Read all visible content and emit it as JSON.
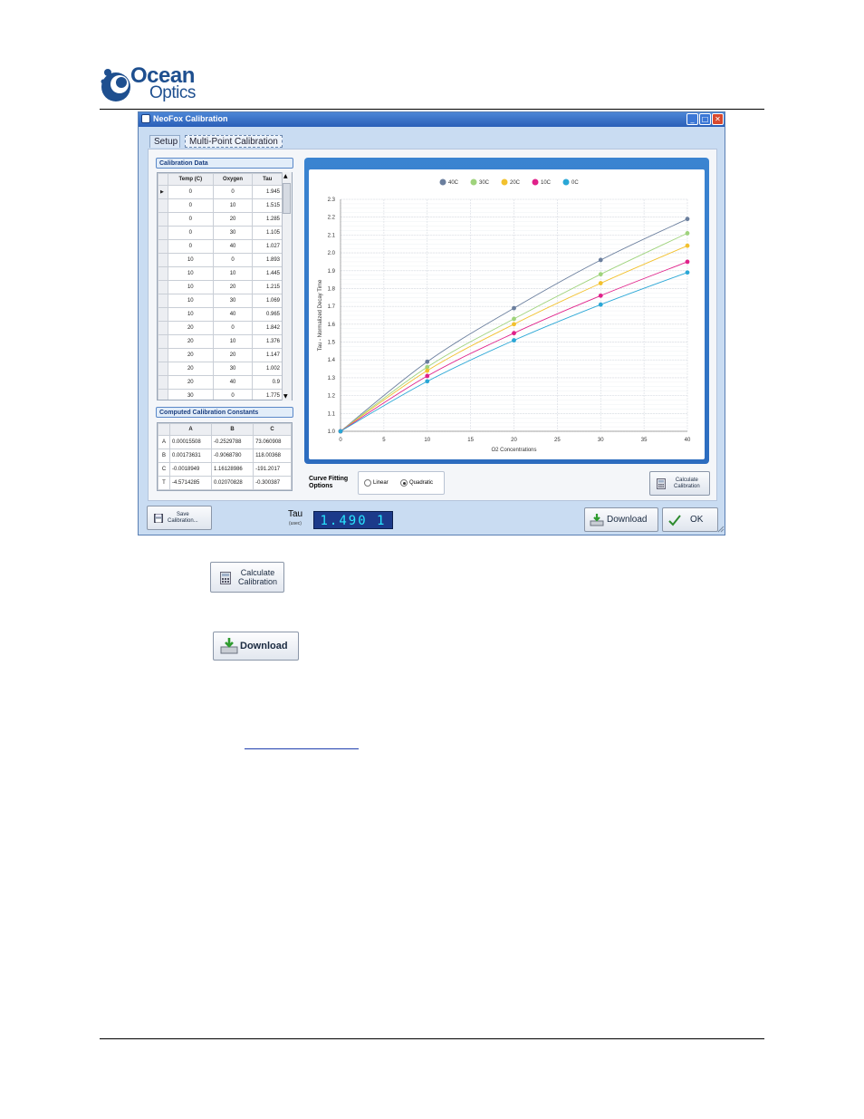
{
  "logo": {
    "line1": "Ocean",
    "line2": "Optics"
  },
  "window": {
    "title": "NeoFox Calibration",
    "controls": {
      "minimize": "_",
      "maximize": "□",
      "close": "✕"
    },
    "tabs": [
      {
        "label": "Setup"
      },
      {
        "label": "Multi-Point Calibration"
      }
    ]
  },
  "calibration_data": {
    "title": "Calibration Data",
    "columns": [
      "Temp (C)",
      "Oxygen",
      "Tau"
    ],
    "rows": [
      [
        "0",
        "0",
        "1.945"
      ],
      [
        "0",
        "10",
        "1.515"
      ],
      [
        "0",
        "20",
        "1.285"
      ],
      [
        "0",
        "30",
        "1.105"
      ],
      [
        "0",
        "40",
        "1.027"
      ],
      [
        "10",
        "0",
        "1.893"
      ],
      [
        "10",
        "10",
        "1.445"
      ],
      [
        "10",
        "20",
        "1.215"
      ],
      [
        "10",
        "30",
        "1.069"
      ],
      [
        "10",
        "40",
        "0.965"
      ],
      [
        "20",
        "0",
        "1.842"
      ],
      [
        "20",
        "10",
        "1.376"
      ],
      [
        "20",
        "20",
        "1.147"
      ],
      [
        "20",
        "30",
        "1.002"
      ],
      [
        "20",
        "40",
        "0.9"
      ],
      [
        "30",
        "0",
        "1.775"
      ]
    ]
  },
  "constants": {
    "title": "Computed Calibration Constants",
    "columns": [
      "",
      "A",
      "B",
      "C"
    ],
    "rows": [
      [
        "A",
        "0.00015508",
        "-0.2529788",
        "73.060908"
      ],
      [
        "B",
        "0.00173631",
        "-0.9068780",
        "118.00368"
      ],
      [
        "C",
        "-0.0018949",
        "1.16128986",
        "-191.2017"
      ],
      [
        "T",
        "-4.5714285",
        "0.02070828",
        "-0.300387"
      ]
    ]
  },
  "curve_fitting": {
    "label_line1": "Curve Fitting",
    "label_line2": "Options",
    "options": [
      "Linear",
      "Quadratic"
    ],
    "selected": "Quadratic"
  },
  "buttons": {
    "calculate_small_line1": "Calculate",
    "calculate_small_line2": "Calibration",
    "save_line1": "Save",
    "save_line2": "Calibration...",
    "download": "Download",
    "ok": "OK",
    "calculate_big_line1": "Calculate",
    "calculate_big_line2": "Calibration",
    "download_big": "Download"
  },
  "tau": {
    "label": "Tau",
    "unit": "(usec)",
    "value": "1.490 1"
  },
  "colors": {
    "c40": "#6b7f9e",
    "c30": "#9fd37c",
    "c20": "#f2c12e",
    "c10": "#e0218a",
    "c0": "#2aa7d6"
  },
  "chart_data": {
    "type": "scatter",
    "xlabel": "O2 Concentrations",
    "ylabel": "Tau - Normalized Decay Time",
    "xlim": [
      0,
      40
    ],
    "ylim": [
      1.0,
      2.3
    ],
    "xticks": [
      0,
      5,
      10,
      15,
      20,
      25,
      30,
      35,
      40
    ],
    "yticks": [
      1.0,
      1.1,
      1.2,
      1.3,
      1.4,
      1.5,
      1.6,
      1.7,
      1.8,
      1.9,
      2.0,
      2.1,
      2.2,
      2.3
    ],
    "legend_position": "top",
    "grid": true,
    "series": [
      {
        "name": "40C",
        "x": [
          0,
          10,
          20,
          30,
          40
        ],
        "y": [
          1.0,
          1.39,
          1.69,
          1.96,
          2.19
        ]
      },
      {
        "name": "30C",
        "x": [
          0,
          10,
          20,
          30,
          40
        ],
        "y": [
          1.0,
          1.36,
          1.63,
          1.88,
          2.11
        ]
      },
      {
        "name": "20C",
        "x": [
          0,
          10,
          20,
          30,
          40
        ],
        "y": [
          1.0,
          1.34,
          1.6,
          1.83,
          2.04
        ]
      },
      {
        "name": "10C",
        "x": [
          0,
          10,
          20,
          30,
          40
        ],
        "y": [
          1.0,
          1.31,
          1.55,
          1.76,
          1.95
        ]
      },
      {
        "name": "0C",
        "x": [
          0,
          10,
          20,
          30,
          40
        ],
        "y": [
          1.0,
          1.28,
          1.51,
          1.71,
          1.89
        ]
      }
    ]
  }
}
